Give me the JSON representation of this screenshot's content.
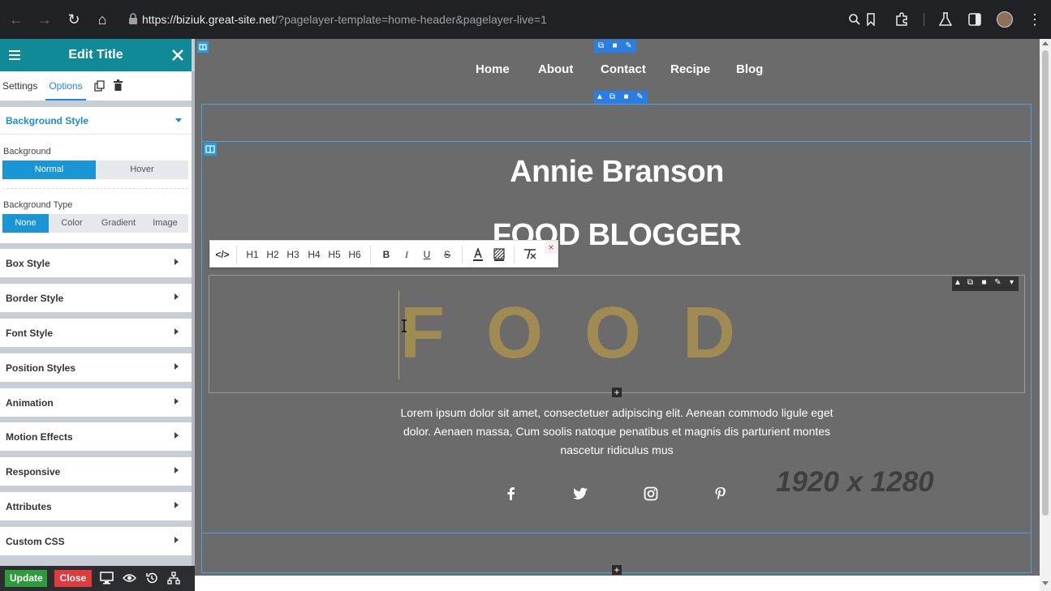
{
  "browser": {
    "url_host": "https://biziuk.great-site.net",
    "url_path": "/?pagelayer-template=home-header&pagelayer-live=1"
  },
  "panel": {
    "title": "Edit Title",
    "tabs": [
      "Settings",
      "Options"
    ],
    "active_tab": "Options",
    "background_style": {
      "label": "Background Style",
      "background_label": "Background",
      "state_options": [
        "Normal",
        "Hover"
      ],
      "state_selected": "Normal",
      "type_label": "Background Type",
      "type_options": [
        "None",
        "Color",
        "Gradient",
        "Image"
      ],
      "type_selected": "None"
    },
    "sections": [
      "Box Style",
      "Border Style",
      "Font Style",
      "Position Styles",
      "Animation",
      "Motion Effects",
      "Responsive",
      "Attributes",
      "Custom CSS"
    ],
    "footer": {
      "update_label": "Update",
      "close_label": "Close"
    }
  },
  "page": {
    "nav": [
      "Home",
      "About",
      "Contact",
      "Recipe",
      "Blog"
    ],
    "hero_name": "Annie Branson",
    "hero_role": "FOOD BLOGGER",
    "food_word": "FOOD",
    "lorem": "Lorem ipsum dolor sit amet, consectetuer adipiscing elit. Aenean commodo ligule eget dolor. Aenaen massa, Cum soolis natoque penatibus et magnis dis parturient montes nascetur ridiculus mus",
    "image_placeholder": "1920 x 1280"
  },
  "toolbar": {
    "headings": [
      "H1",
      "H2",
      "H3",
      "H4",
      "H5",
      "H6"
    ],
    "format": [
      "B",
      "I",
      "U",
      "S"
    ]
  },
  "colors": {
    "panel_header": "#0f8a96",
    "accent_blue": "#1a95d6",
    "canvas_bg": "#6b6b6b",
    "food_gold": "#a08c52",
    "update_green": "#2e9c3a",
    "close_red": "#e03a3a"
  }
}
